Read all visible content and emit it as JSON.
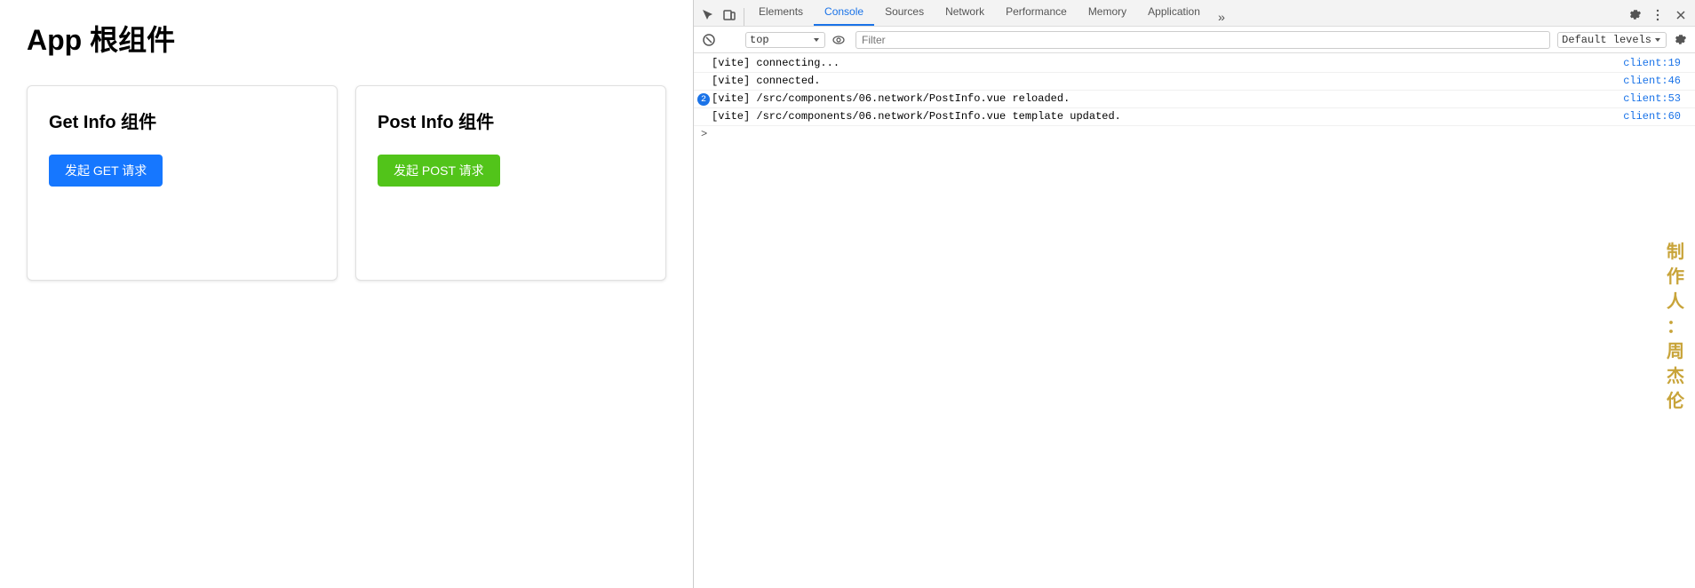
{
  "app": {
    "title": "App 根组件",
    "components": [
      {
        "title": "Get Info 组件",
        "button_label": "发起 GET 请求",
        "button_type": "get"
      },
      {
        "title": "Post Info 组件",
        "button_label": "发起 POST 请求",
        "button_type": "post"
      }
    ]
  },
  "watermark": {
    "text": "制作人：周杰伦",
    "chars": [
      "制",
      "作",
      "人",
      "：",
      "周",
      "杰",
      "伦"
    ]
  },
  "devtools": {
    "tabs": [
      {
        "label": "Elements",
        "active": false
      },
      {
        "label": "Console",
        "active": true
      },
      {
        "label": "Sources",
        "active": false
      },
      {
        "label": "Network",
        "active": false
      },
      {
        "label": "Performance",
        "active": false
      },
      {
        "label": "Memory",
        "active": false
      },
      {
        "label": "Application",
        "active": false
      }
    ],
    "tabs_more_label": "»",
    "console": {
      "filter_placeholder": "Filter",
      "context_label": "top",
      "levels_label": "Default levels",
      "lines": [
        {
          "text": "[vite] connecting...",
          "link": "client:19",
          "badge": null
        },
        {
          "text": "[vite] connected.",
          "link": "client:46",
          "badge": null
        },
        {
          "text": "[vite] /src/components/06.network/PostInfo.vue reloaded.",
          "link": "client:53",
          "badge": "2"
        },
        {
          "text": "[vite] /src/components/06.network/PostInfo.vue template updated.",
          "link": "client:60",
          "badge": null
        }
      ],
      "caret": ">"
    }
  }
}
